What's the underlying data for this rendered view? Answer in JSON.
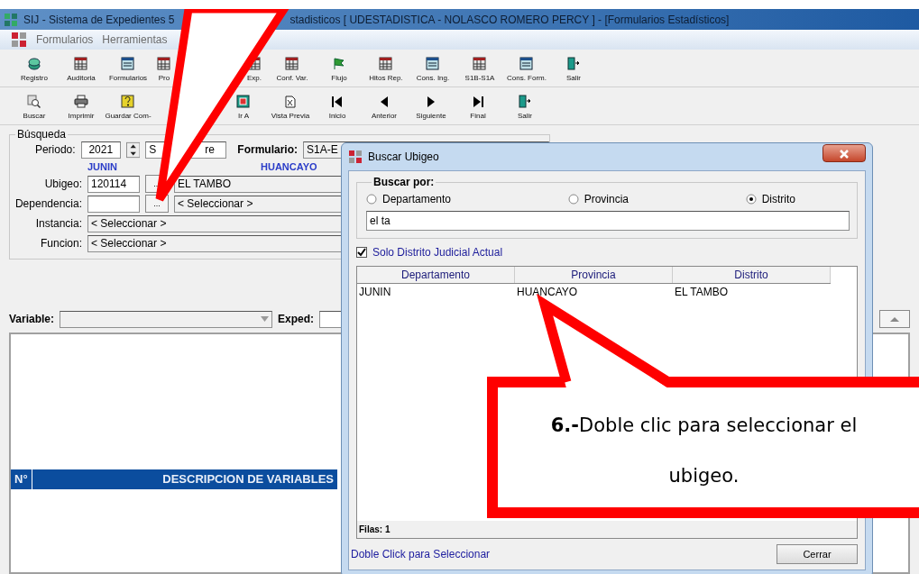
{
  "window": {
    "title_parts": [
      "SIJ - Sistema de Expedientes 5",
      "stadisticos  [ UDESTADISTICA - NOLASCO ROMERO PERCY ] - [Formularios Estadísticos]"
    ]
  },
  "menu": [
    "Formularios",
    "Herramientas"
  ],
  "toolbar_top": [
    "Registro",
    "Auditoria",
    "Formularios",
    "Pro",
    "Exp.",
    "Conf. Var.",
    "Flujo",
    "Hitos Rep.",
    "Cons. Ing.",
    "S1B-S1A",
    "Cons. Form.",
    "Salir"
  ],
  "toolbar_nav": [
    "Buscar",
    "Imprimir",
    "Guardar Com-",
    "Ir A",
    "Vista Previa",
    "Inicio",
    "Anterior",
    "Siguiente",
    "Final",
    "Salir"
  ],
  "search": {
    "legend": "Búsqueda",
    "periodo_label": "Periodo:",
    "year": "2021",
    "period_parts": [
      "S",
      "re"
    ],
    "formulario_label": "Formulario:",
    "formulario": "S1A-E",
    "departamento": "JUNIN",
    "provincia": "HUANCAYO",
    "rows": [
      {
        "label": "Ubigeo:",
        "code": "120114",
        "button": "...",
        "value": "EL TAMBO"
      },
      {
        "label": "Dependencia:",
        "code": "",
        "button": "...",
        "value": "< Seleccionar >"
      },
      {
        "label": "Instancia:",
        "value": "< Seleccionar >"
      },
      {
        "label": "Funcion:",
        "value": "< Seleccionar >"
      }
    ]
  },
  "filter": {
    "variable_label": "Variable:",
    "exped_label": "Exped:"
  },
  "grid": {
    "columns": [
      "N°",
      "DESCRIPCION DE VARIABLES"
    ]
  },
  "dialog": {
    "title": "Buscar Ubigeo",
    "group": "Buscar por:",
    "options": [
      {
        "label": "Departamento",
        "selected": false
      },
      {
        "label": "Provincia",
        "selected": false
      },
      {
        "label": "Distrito",
        "selected": true
      }
    ],
    "query": "el ta",
    "checkbox": {
      "label": "Solo Distrito Judicial Actual",
      "checked": true
    },
    "columns": [
      "Departamento",
      "Provincia",
      "Distrito"
    ],
    "rows": [
      [
        "JUNIN",
        "HUANCAYO",
        "EL TAMBO"
      ]
    ],
    "count": "Filas: 1",
    "hint": "Doble Click para Seleccionar",
    "close_button": "Cerrar"
  },
  "callout": {
    "text": "**6.-**Doble clic para seleccionar el ubigeo."
  }
}
